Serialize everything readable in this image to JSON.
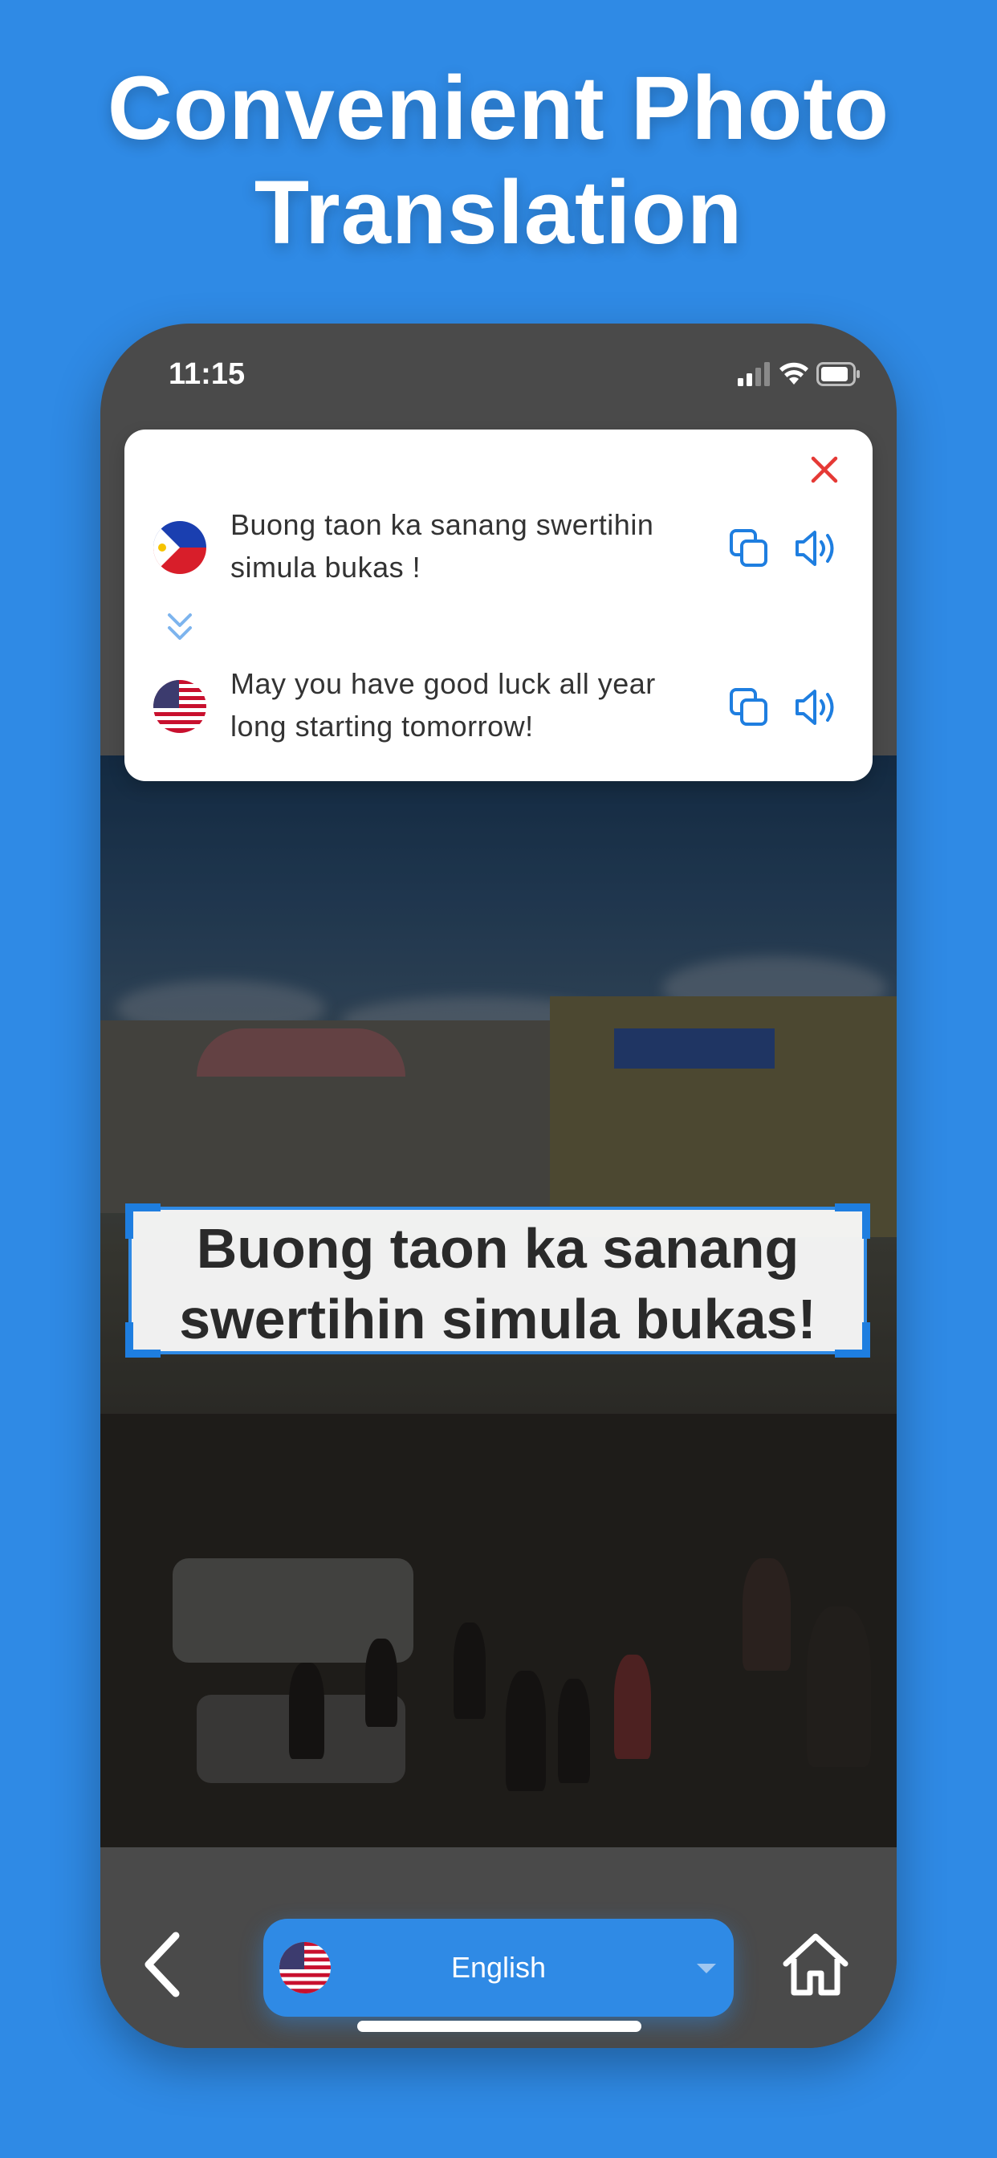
{
  "headline": {
    "line1": "Convenient Photo",
    "line2": "Translation"
  },
  "status_bar": {
    "time": "11:15",
    "icons": [
      "signal-icon",
      "wifi-icon",
      "battery-icon"
    ]
  },
  "translation_card": {
    "close_icon": "close-icon",
    "source": {
      "flag": "philippines-flag-icon",
      "text": "Buong taon ka sanang swertihin simula bukas !",
      "copy_icon": "copy-icon",
      "speak_icon": "speaker-icon"
    },
    "swap_icon": "chevrons-down-icon",
    "target": {
      "flag": "us-flag-icon",
      "text": "May you have good luck all year long starting tomorrow!",
      "copy_icon": "copy-icon",
      "speak_icon": "speaker-icon"
    }
  },
  "photo": {
    "recognized_text": "Buong taon ka sanang swertihin simula bukas!"
  },
  "bottom_bar": {
    "back_icon": "chevron-left-icon",
    "language": {
      "flag": "us-flag-icon",
      "label": "English",
      "caret_icon": "caret-down-icon"
    },
    "home_icon": "home-icon"
  },
  "colors": {
    "background": "#2f8ae5",
    "accent": "#1e7ee0",
    "close": "#e53935",
    "phone": "#4a4a4a"
  }
}
